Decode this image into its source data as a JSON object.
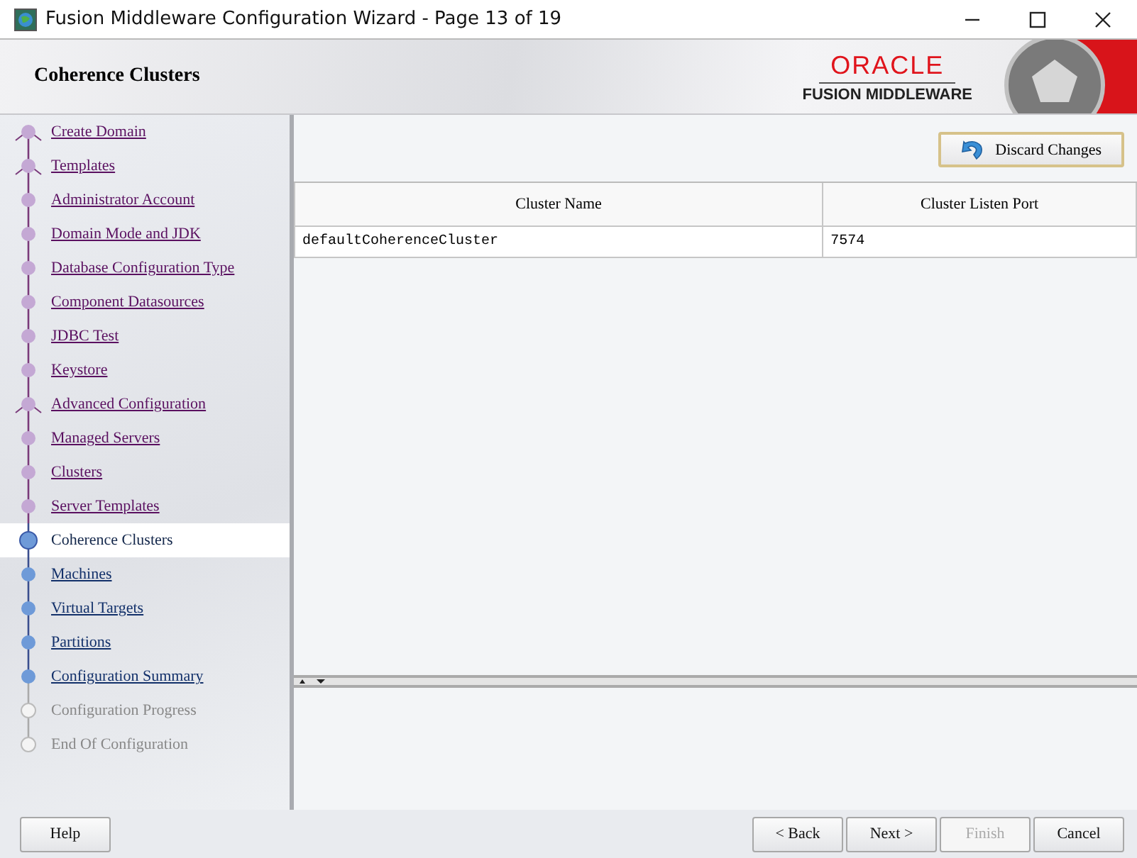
{
  "window": {
    "title": "Fusion Middleware Configuration Wizard - Page 13 of 19"
  },
  "header": {
    "title": "Coherence Clusters",
    "logo_top": "ORACLE",
    "logo_bottom": "FUSION MIDDLEWARE"
  },
  "steps": [
    {
      "label": "Create Domain",
      "kind": "visited",
      "branch": true,
      "selected": false
    },
    {
      "label": "Templates",
      "kind": "visited",
      "branch": true,
      "selected": false
    },
    {
      "label": "Administrator Account",
      "kind": "visited",
      "branch": false,
      "selected": false
    },
    {
      "label": "Domain Mode and JDK",
      "kind": "visited",
      "branch": false,
      "selected": false
    },
    {
      "label": "Database Configuration Type",
      "kind": "visited",
      "branch": false,
      "selected": false
    },
    {
      "label": "Component Datasources",
      "kind": "visited",
      "branch": false,
      "selected": false
    },
    {
      "label": "JDBC Test",
      "kind": "visited",
      "branch": false,
      "selected": false
    },
    {
      "label": "Keystore",
      "kind": "visited",
      "branch": false,
      "selected": false
    },
    {
      "label": "Advanced Configuration",
      "kind": "visited",
      "branch": true,
      "selected": false
    },
    {
      "label": "Managed Servers",
      "kind": "visited",
      "branch": false,
      "selected": false
    },
    {
      "label": "Clusters",
      "kind": "visited",
      "branch": false,
      "selected": false
    },
    {
      "label": "Server Templates",
      "kind": "visited",
      "branch": false,
      "selected": false
    },
    {
      "label": "Coherence Clusters",
      "kind": "current",
      "branch": false,
      "selected": true
    },
    {
      "label": "Machines",
      "kind": "link",
      "branch": false,
      "selected": false
    },
    {
      "label": "Virtual Targets",
      "kind": "link",
      "branch": false,
      "selected": false
    },
    {
      "label": "Partitions",
      "kind": "link",
      "branch": false,
      "selected": false
    },
    {
      "label": "Configuration Summary",
      "kind": "link",
      "branch": false,
      "selected": false
    },
    {
      "label": "Configuration Progress",
      "kind": "disabled",
      "branch": false,
      "selected": false
    },
    {
      "label": "End Of Configuration",
      "kind": "disabled",
      "branch": false,
      "selected": false
    }
  ],
  "discard_button": {
    "label": "Discard Changes"
  },
  "table": {
    "columns": [
      "Cluster Name",
      "Cluster Listen Port"
    ],
    "rows": [
      [
        "defaultCoherenceCluster",
        "7574"
      ]
    ]
  },
  "buttons": [
    {
      "label": "Help",
      "disabled": false
    },
    {
      "label": "< Back",
      "disabled": false
    },
    {
      "label": "Next >",
      "disabled": false
    },
    {
      "label": "Finish",
      "disabled": true
    },
    {
      "label": "Cancel",
      "disabled": false
    }
  ]
}
